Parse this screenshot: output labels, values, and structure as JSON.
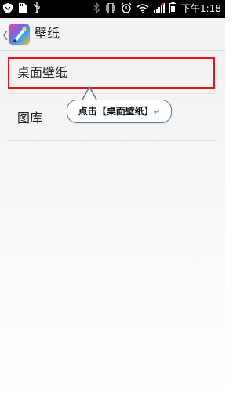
{
  "status_bar": {
    "time": "下午1:18",
    "icons": [
      "shield-icon",
      "sd-card-icon",
      "usb-icon",
      "bluetooth-icon",
      "vibrate-icon",
      "alarm-icon",
      "wifi-icon",
      "signal-icon",
      "battery-icon"
    ]
  },
  "action_bar": {
    "title": "壁纸",
    "back_icon": "chevron-left-icon",
    "app_icon": "wallpaper-brush-icon"
  },
  "list": {
    "items": [
      {
        "label": "桌面壁纸"
      },
      {
        "label": "图库"
      }
    ]
  },
  "annotation": {
    "callout_text": "点击【桌面壁纸】",
    "return_mark": "↵",
    "highlight_color": "#e8121d",
    "callout_border_color": "#5b7ca3"
  }
}
